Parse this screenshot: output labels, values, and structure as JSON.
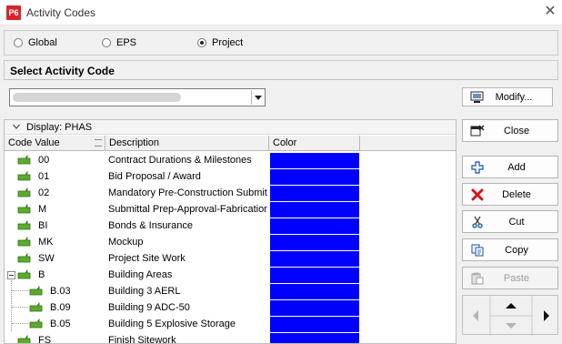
{
  "window": {
    "app_icon": "P6",
    "title": "Activity Codes",
    "close": "✕"
  },
  "scope": {
    "options": [
      "Global",
      "EPS",
      "Project"
    ],
    "selected": "Project"
  },
  "section_title": "Select Activity Code",
  "buttons": {
    "modify": "Modify...",
    "close": "Close",
    "add": "Add",
    "delete": "Delete",
    "cut": "Cut",
    "copy": "Copy",
    "paste": "Paste"
  },
  "grid": {
    "group_label": "Display: PHAS",
    "columns": {
      "code": "Code Value",
      "description": "Description",
      "color": "Color"
    },
    "row_color": "#0000ff",
    "rows": [
      {
        "code": "00",
        "description": "Contract Durations & Milestones"
      },
      {
        "code": "01",
        "description": "Bid Proposal  / Award"
      },
      {
        "code": "02",
        "description": "Mandatory Pre-Construction Submitt"
      },
      {
        "code": "M",
        "description": "Submittal Prep-Approval-Fabrication"
      },
      {
        "code": "BI",
        "description": "Bonds & Insurance"
      },
      {
        "code": "MK",
        "description": "Mockup"
      },
      {
        "code": "SW",
        "description": "Project Site Work"
      },
      {
        "code": "B",
        "description": "Building Areas"
      },
      {
        "code": "B.03",
        "description": "Building 3 AERL"
      },
      {
        "code": "B.09",
        "description": "Building 9 ADC-50"
      },
      {
        "code": "B.05",
        "description": "Building 5 Explosive Storage"
      },
      {
        "code": "FS",
        "description": "Finish Sitework"
      }
    ]
  }
}
